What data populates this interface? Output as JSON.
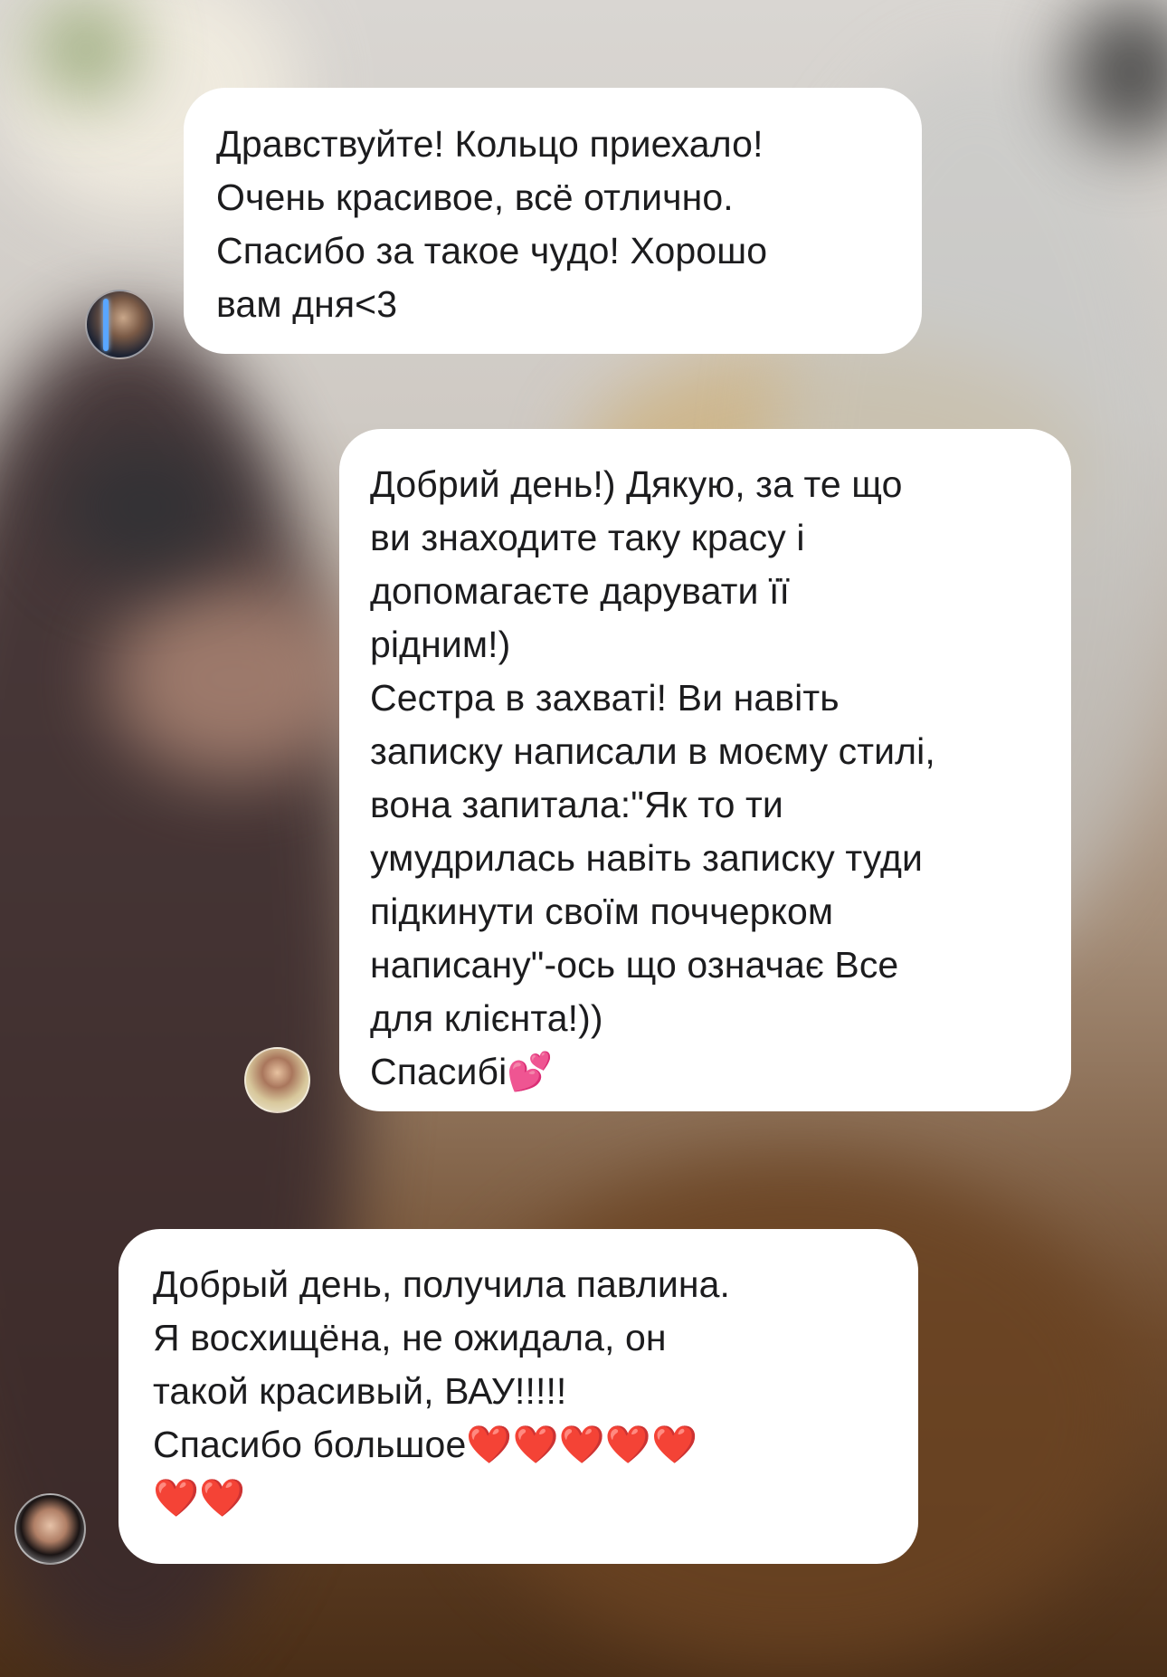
{
  "messages": [
    {
      "sender": "customer",
      "text": "Дравствуйте! Кольцо приехало!\nОчень красивое, всё отлично.\nСпасибо за такое чудо! Хорошо\nвам дня<3"
    },
    {
      "sender": "customer",
      "text": "Добрий день!) Дякую, за те що\nви знаходите таку красу і\nдопомагаєте дарувати її\nрідним!)\nСестра в захваті! Ви навіть\nзаписку написали в моєму стилі,\nвона запитала:\"Як то ти\nумудрилась навіть записку туди\nпідкинути своїм поччерком\nнаписану\"-ось що означає Все\nдля клієнта!))\nСпасибі💕"
    },
    {
      "sender": "customer",
      "text": "Добрый день, получила павлина.\nЯ восхищёна, не ожидала, он\nтакой красивый, ВАУ!!!!!\nСпасибо большое❤️❤️❤️❤️❤️\n❤️❤️"
    }
  ],
  "colors": {
    "bubble_bg": "#ffffff",
    "text": "#1c1c1e"
  }
}
